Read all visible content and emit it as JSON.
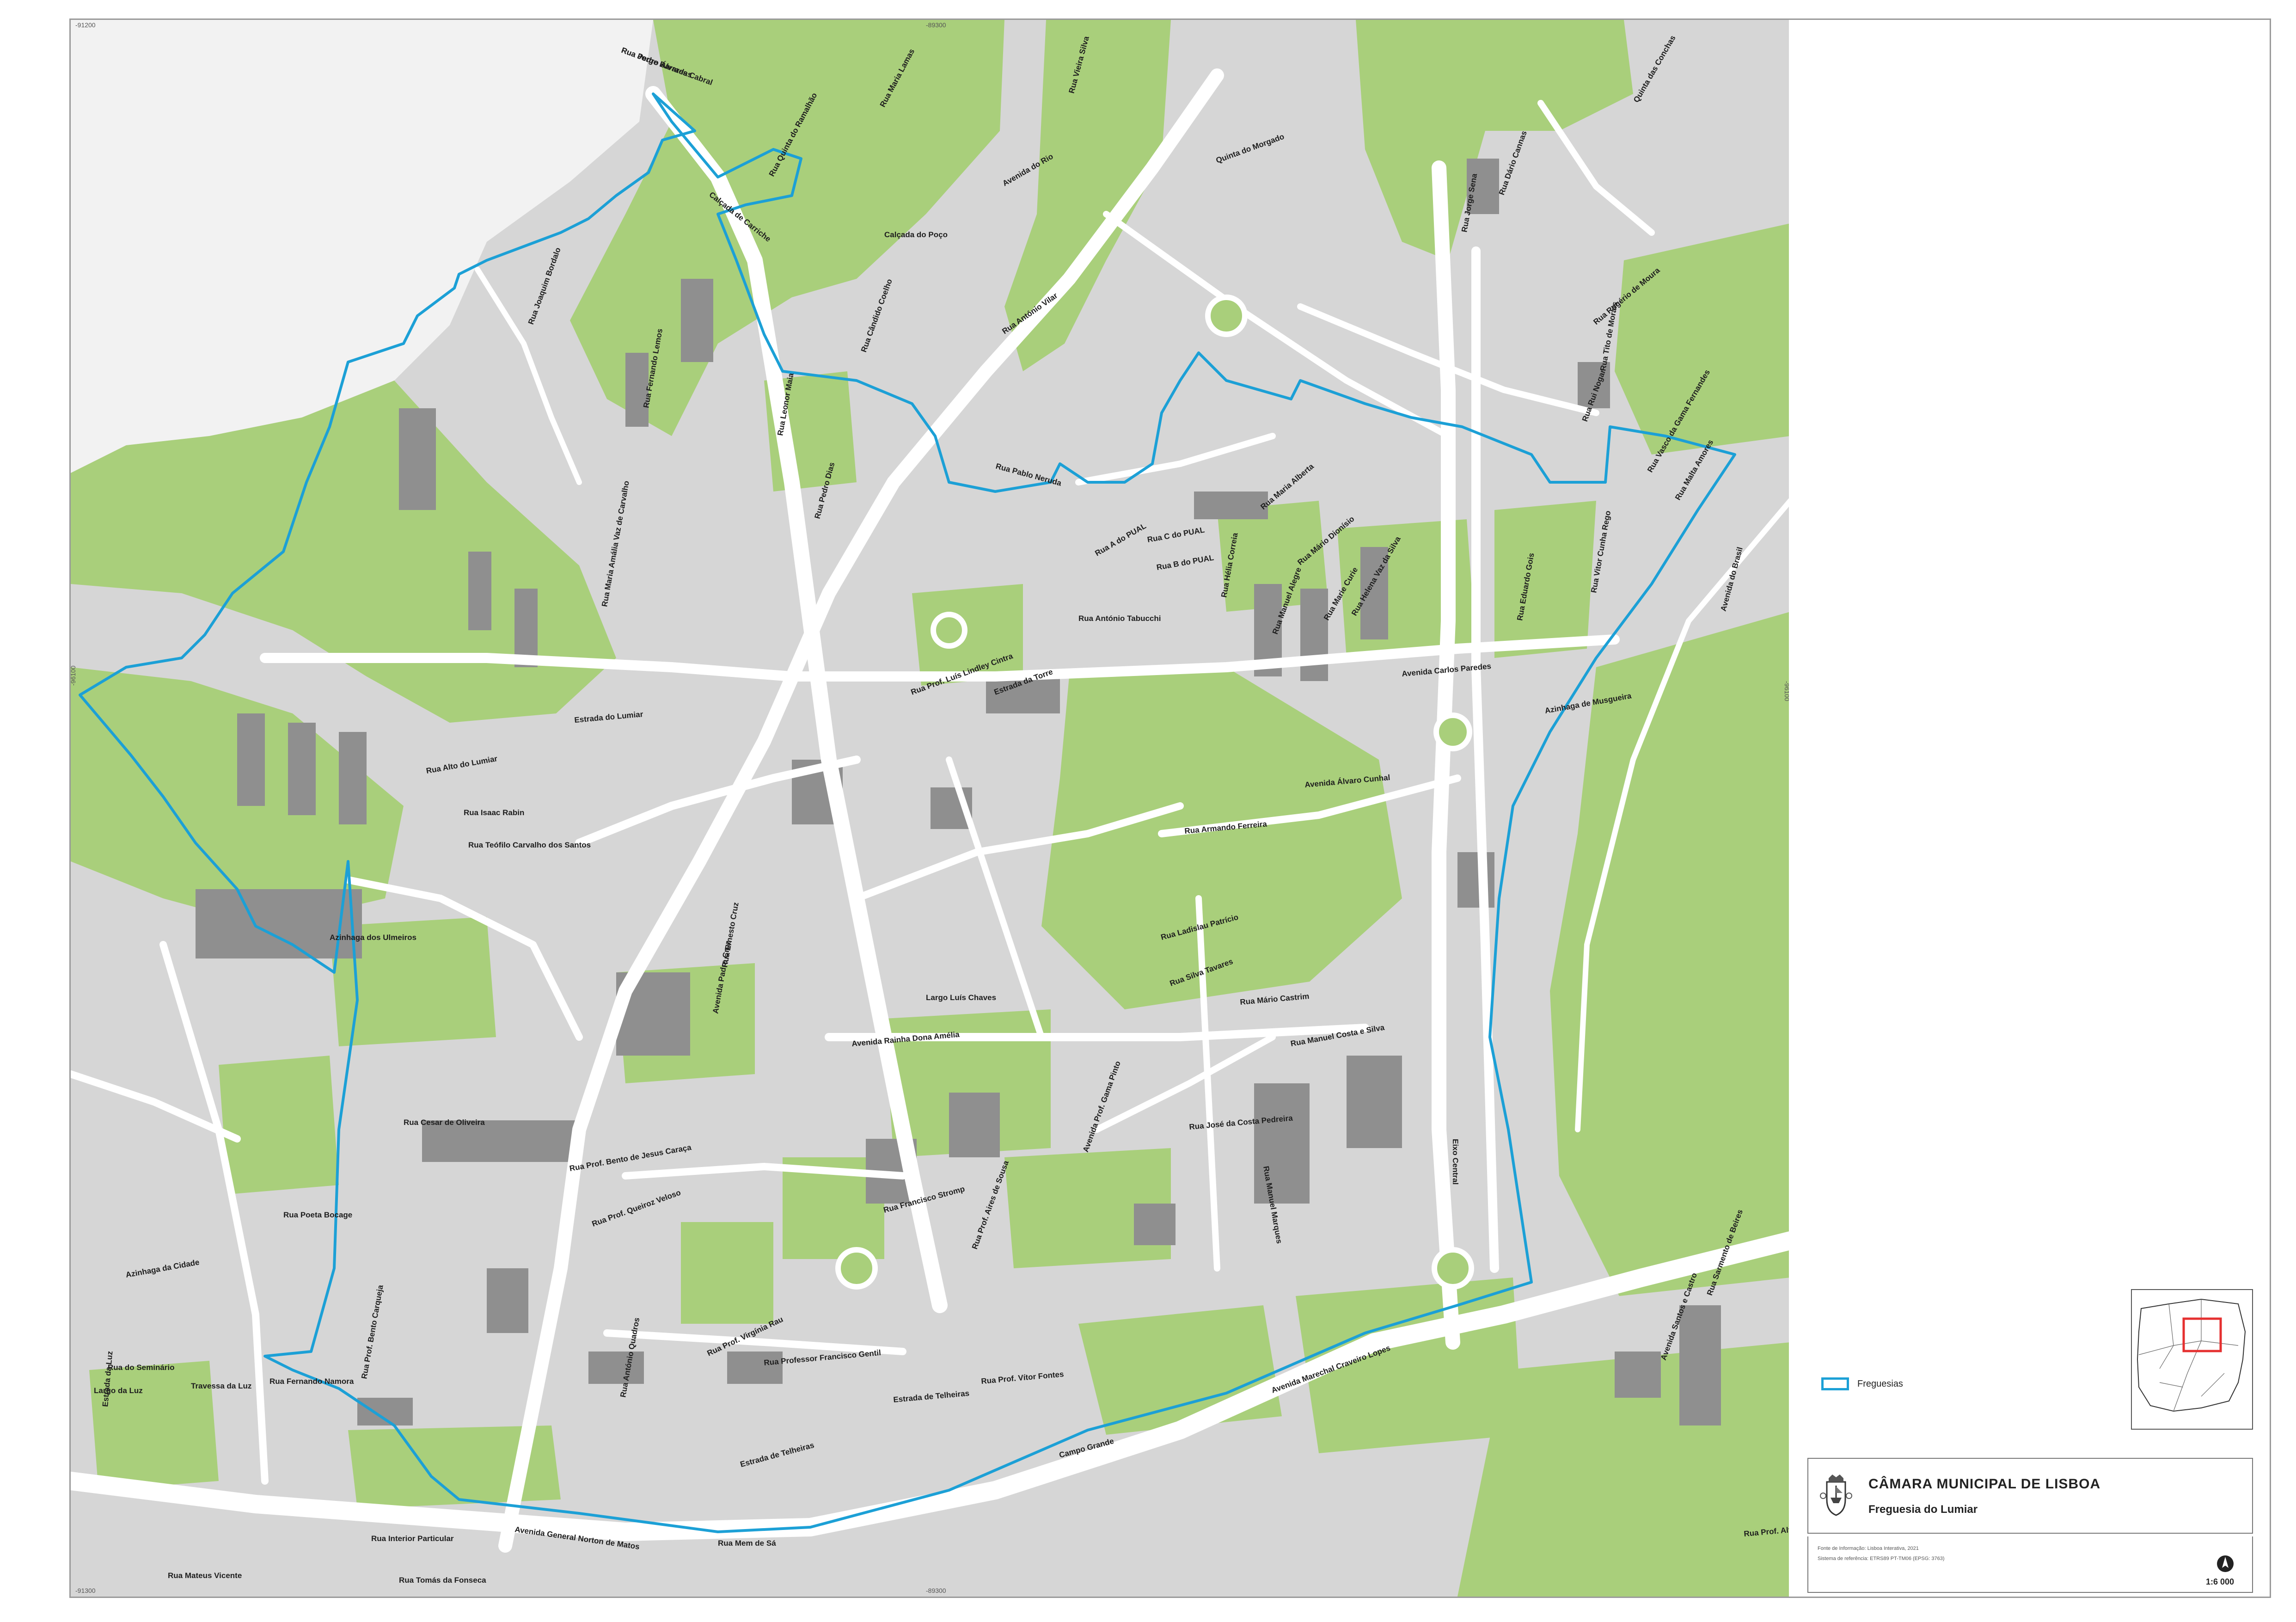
{
  "map": {
    "coords": {
      "top_left": "-91200",
      "top_center": "-89300",
      "bottom_left": "-91300",
      "bottom_center": "-89300",
      "left_middle": "-96100",
      "right_middle": "-96100"
    },
    "colors": {
      "green_space": "#a9cf7b",
      "built_area": "#d6d6d6",
      "buildings": "#8f8f8f",
      "roads": "#ffffff",
      "boundary": "#1ca0d6",
      "outside_area": "#f2f2f2"
    },
    "streets": [
      "Rua Pedro Álvares Cabral",
      "Calçada de Carriche",
      "Calçada do Poço",
      "Rua Quinta do Ramalhão",
      "Avenida do Rio",
      "Quinta do Morgado",
      "Rua Vieira Silva",
      "Rua Maria Lamas",
      "Rua Joaquim Bordalo",
      "Rua Fernando Lemos",
      "Rua Pablo Neruda",
      "Rua Pedro Dias",
      "Rua Leonor Maia",
      "Rua Cândido Coelho",
      "Rua António Vilar",
      "Rua Helena Vaz da Silva",
      "Rua Prof. Luís Lindley Cintra",
      "Estrada do Lumiar",
      "Estrada da Torre",
      "Rua C do PUAL",
      "Rua B do PUAL",
      "Rua A do PUAL",
      "Rua António Tabucchi",
      "Rua Manuel Alegre",
      "Rua Hélia Correia",
      "Rua Maria Alberta",
      "Rua Mário Dionísio",
      "Avenida Carlos Paredes",
      "Azinhaga de Musgueira",
      "Avenida Álvaro Cunhal",
      "Rua Armando Ferreira",
      "Rua Ladislau Patrício",
      "Rua Silva Tavares",
      "Rua Mário Castrim",
      "Rua Manuel Costa e Silva",
      "Avenida Rainha Dona Amélia",
      "Largo Luís Chaves",
      "Rua José da Costa Pedreira",
      "Rua Manuel Marques",
      "Rua Professor Francisco Gentil",
      "Rua Francisco Stromp",
      "Rua Prof. Vítor Fontes",
      "Estrada de Telheiras",
      "Campo Grande",
      "Avenida General Norton de Matos",
      "Avenida Marechal Craveiro Lopes",
      "Rua Mem de Sá",
      "Rua Interior Particular",
      "Rua Tomás da Fonseca",
      "Rua Mateus Vicente",
      "Estrada da Luz",
      "Largo da Luz",
      "Rua do Seminário",
      "Travessa da Luz",
      "Rua Fernando Namora",
      "Rua Poeta Bocage",
      "Rua Cesar de Oliveira",
      "Azinhaga dos Ulmeiros",
      "Rua Isaac Rabin",
      "Rua Teófilo Carvalho dos Santos",
      "Rua Prof. Queiroz Veloso",
      "Rua Prof. Bento de Jesus Caraça",
      "Rua Prof. Virgínia Rau",
      "Avenida Padre Cruz",
      "Rua Ernesto Cruz",
      "Eixo Central",
      "Estrada de Telheiras",
      "Rua Alto do Lumiar",
      "Rua Maria Amália Vaz de Carvalho",
      "Rua Jorge Sena",
      "Rua Dário Cannas",
      "Rua Rogério de Moura",
      "Rua Tito de Morais",
      "Rua Rui Nogar",
      "Rua Malta Amores",
      "Rua Vasco da Gama Fernandes",
      "Rua Vitor Cunha Rego",
      "Rua Eduardo Gois",
      "Rua Marie Curie",
      "Quinta das Conchas",
      "Azinhaga da Cidade",
      "Rua Sarmento de Beires",
      "Rua Prof. Alfredo Sousa",
      "Avenida do Brasil",
      "Avenida Santos e Castro",
      "Rua Prof. Bento Carqueja",
      "Rua António Quadros",
      "Rua Prof. Aires de Sousa",
      "Avenida Prof. Gama Pinto",
      "Rua Jorge Barradas"
    ]
  },
  "legend": {
    "boundary_label": "Freguesias"
  },
  "title_block": {
    "org_name": "CÂMARA MUNICIPAL DE LISBOA",
    "sheet_title": "Freguesia do Lumiar"
  },
  "info_block": {
    "source": "Fonte de Informação: Lisboa Interativa, 2021",
    "reference": "Sistema de referência: ETRS89 PT-TM06 (EPSG: 3763)",
    "scale": "1:6 000"
  }
}
